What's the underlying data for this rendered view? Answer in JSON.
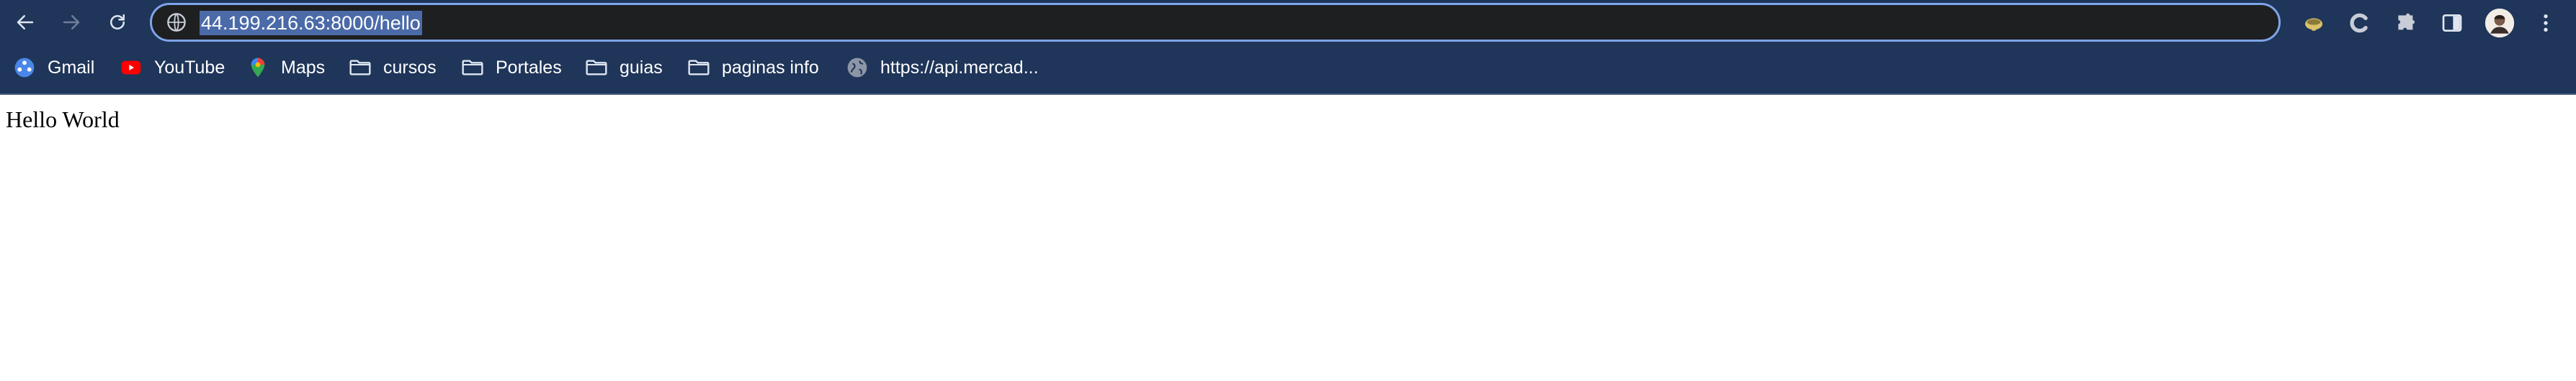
{
  "browser": {
    "address_bar": {
      "url": "44.199.216.63:8000/hello"
    },
    "nav": {
      "back_icon": "arrow-left-icon",
      "forward_icon": "arrow-right-icon",
      "reload_icon": "reload-icon"
    },
    "extensions": [
      {
        "name": "extension-bowl-icon"
      },
      {
        "name": "extension-c-icon"
      },
      {
        "name": "puzzle-extensions-icon"
      },
      {
        "name": "side-panel-icon"
      },
      {
        "name": "profile-avatar"
      },
      {
        "name": "kebab-menu-icon"
      }
    ],
    "bookmarks": [
      {
        "label": "Gmail",
        "icon": "google-apps-icon"
      },
      {
        "label": "YouTube",
        "icon": "youtube-icon"
      },
      {
        "label": "Maps",
        "icon": "maps-pin-icon"
      },
      {
        "label": "cursos",
        "icon": "folder-icon"
      },
      {
        "label": "Portales",
        "icon": "folder-icon"
      },
      {
        "label": "guias",
        "icon": "folder-icon"
      },
      {
        "label": "paginas info",
        "icon": "folder-icon"
      },
      {
        "label": "https://api.mercad...",
        "icon": "globe-icon"
      }
    ],
    "colors": {
      "toolbar_bg": "#1f3559",
      "omnibox_bg": "#1e1f21",
      "omnibox_border": "#7ea4e8",
      "selection_bg": "#4b6aa8"
    }
  },
  "page": {
    "body_text": "Hello World"
  }
}
